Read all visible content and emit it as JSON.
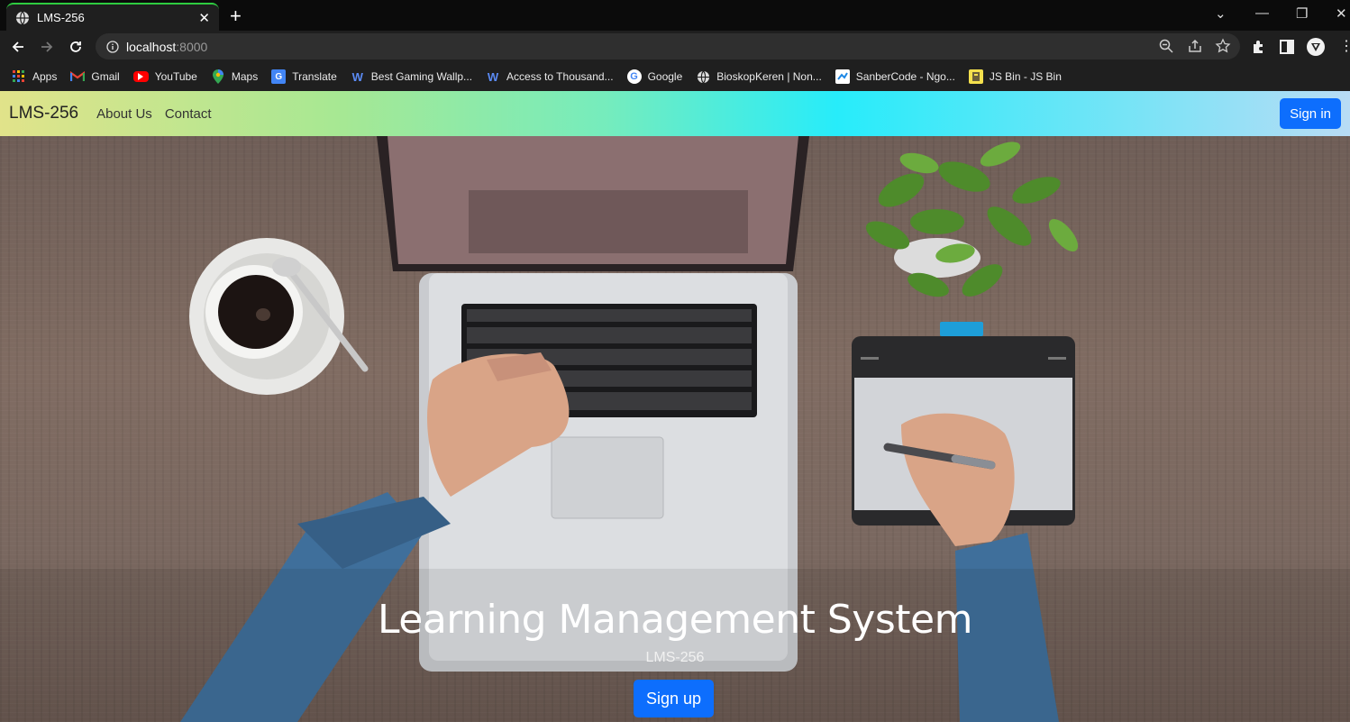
{
  "browser": {
    "tab": {
      "title": "LMS-256"
    },
    "address": {
      "host": "localhost",
      "port": ":8000"
    },
    "bookmarks": [
      {
        "label": "Apps",
        "icon": "apps-grid-icon"
      },
      {
        "label": "Gmail",
        "icon": "gmail-icon"
      },
      {
        "label": "YouTube",
        "icon": "youtube-icon"
      },
      {
        "label": "Maps",
        "icon": "maps-icon"
      },
      {
        "label": "Translate",
        "icon": "translate-icon"
      },
      {
        "label": "Best Gaming Wallp...",
        "icon": "wallpaper-site-icon"
      },
      {
        "label": "Access to Thousand...",
        "icon": "wallpaper-site-icon"
      },
      {
        "label": "Google",
        "icon": "google-icon"
      },
      {
        "label": "BioskopKeren | Non...",
        "icon": "globe-icon"
      },
      {
        "label": "SanberCode - Ngo...",
        "icon": "sanbercode-icon"
      },
      {
        "label": "JS Bin - JS Bin",
        "icon": "jsbin-icon"
      }
    ]
  },
  "navbar": {
    "brand": "LMS-256",
    "links": [
      "About Us",
      "Contact"
    ],
    "signin_label": "Sign in"
  },
  "hero": {
    "title": "Learning Management System",
    "subtitle": "LMS-256",
    "signup_label": "Sign up"
  },
  "colors": {
    "primary_button": "#0d6efd",
    "navbar_gradient": [
      "#e1e38a",
      "#a7e893",
      "#27ecfa",
      "#b8dcf5"
    ],
    "chrome_dark": "#1f1f1f",
    "active_tab_accent": "#2ecc40"
  }
}
